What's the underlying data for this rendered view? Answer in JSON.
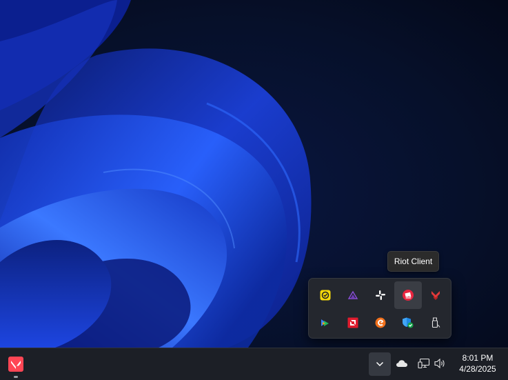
{
  "tooltip": {
    "text": "Riot Client"
  },
  "tray_flyout": {
    "items": [
      {
        "name": "tray-app-yellow-check-icon"
      },
      {
        "name": "tray-app-purple-triangle-icon"
      },
      {
        "name": "tray-app-slack-icon"
      },
      {
        "name": "tray-app-riot-client-icon",
        "hovered": true
      },
      {
        "name": "tray-app-red-chevron-icon"
      },
      {
        "name": "tray-app-play-arrows-icon"
      },
      {
        "name": "tray-app-amd-icon"
      },
      {
        "name": "tray-app-orange-circle-icon"
      },
      {
        "name": "tray-app-windows-security-icon"
      },
      {
        "name": "tray-app-usb-drive-icon"
      }
    ]
  },
  "taskbar": {
    "pinned_app": "valorant-icon",
    "overflow_button": "chevron-down-icon",
    "system_icons": [
      "onedrive-cloud-icon",
      "network-icon",
      "volume-icon"
    ],
    "clock": {
      "time": "8:01 PM",
      "date": "4/28/2025"
    }
  },
  "colors": {
    "taskbar_bg": "#1c1f26",
    "flyout_bg": "#24272e",
    "wallpaper_dark": "#050a1c",
    "wallpaper_blue": "#1f4ef0",
    "accent_red": "#e8243f"
  }
}
